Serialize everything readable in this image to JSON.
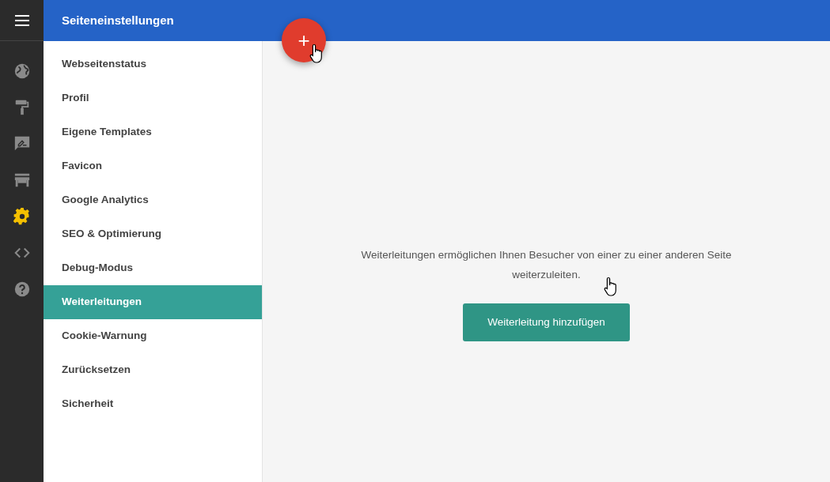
{
  "header": {
    "title": "Seiteneinstellungen",
    "fab_label": "+"
  },
  "rail": [
    {
      "kind": "globe",
      "selected": false
    },
    {
      "kind": "roller",
      "selected": false
    },
    {
      "kind": "feedback",
      "selected": false
    },
    {
      "kind": "store",
      "selected": false
    },
    {
      "kind": "gear",
      "selected": true
    },
    {
      "kind": "code",
      "selected": false
    },
    {
      "kind": "help",
      "selected": false
    }
  ],
  "menu": [
    {
      "label": "Webseitenstatus",
      "selected": false
    },
    {
      "label": "Profil",
      "selected": false
    },
    {
      "label": "Eigene Templates",
      "selected": false
    },
    {
      "label": "Favicon",
      "selected": false
    },
    {
      "label": "Google Analytics",
      "selected": false
    },
    {
      "label": "SEO & Optimierung",
      "selected": false
    },
    {
      "label": "Debug-Modus",
      "selected": false
    },
    {
      "label": "Weiterleitungen",
      "selected": true
    },
    {
      "label": "Cookie-Warnung",
      "selected": false
    },
    {
      "label": "Zurücksetzen",
      "selected": false
    },
    {
      "label": "Sicherheit",
      "selected": false
    }
  ],
  "content": {
    "message": "Weiterleitungen ermöglichen Ihnen Besucher von einer zu einer anderen Seite weiterzuleiten.",
    "button": "Weiterleitung hinzufügen"
  }
}
